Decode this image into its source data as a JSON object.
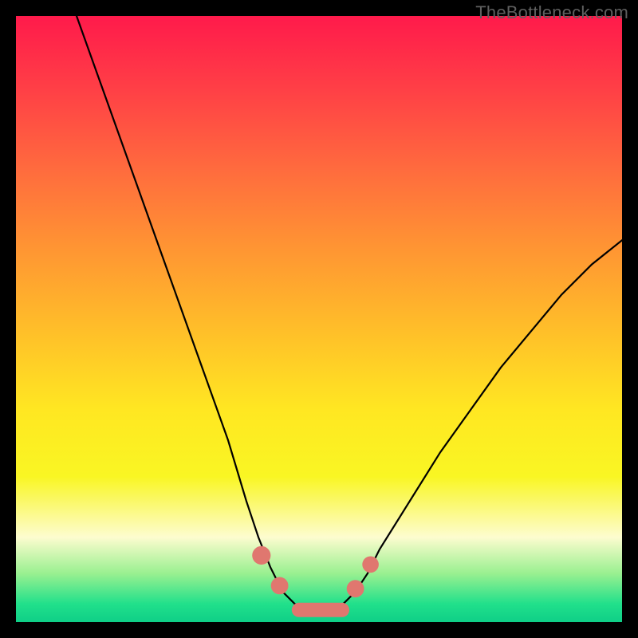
{
  "attribution": "TheBottleneck.com",
  "chart_data": {
    "type": "line",
    "title": "",
    "xlabel": "",
    "ylabel": "",
    "xlim": [
      0,
      100
    ],
    "ylim": [
      0,
      100
    ],
    "series": [
      {
        "name": "bottleneck-curve",
        "x": [
          10,
          15,
          20,
          25,
          30,
          35,
          38,
          40,
          42,
          44,
          46,
          48,
          50,
          52,
          54,
          56,
          58,
          60,
          65,
          70,
          75,
          80,
          85,
          90,
          95,
          100
        ],
        "y": [
          100,
          86,
          72,
          58,
          44,
          30,
          20,
          14,
          9,
          5,
          3,
          2,
          2,
          2,
          3,
          5,
          8,
          12,
          20,
          28,
          35,
          42,
          48,
          54,
          59,
          63
        ]
      }
    ],
    "markers": [
      {
        "name": "left-shoulder-top",
        "x": 40.5,
        "y": 11.0,
        "r": 1.7
      },
      {
        "name": "left-shoulder-bottom",
        "x": 43.5,
        "y": 6.0,
        "r": 1.6
      },
      {
        "name": "trough-blob",
        "x": 50.0,
        "y": 2.0,
        "r": 1.0
      },
      {
        "name": "right-shoulder-low",
        "x": 56.0,
        "y": 5.5,
        "r": 1.6
      },
      {
        "name": "right-shoulder-high",
        "x": 58.5,
        "y": 9.5,
        "r": 1.5
      }
    ],
    "colors": {
      "curve": "#000000",
      "marker": "#e0776f"
    }
  }
}
